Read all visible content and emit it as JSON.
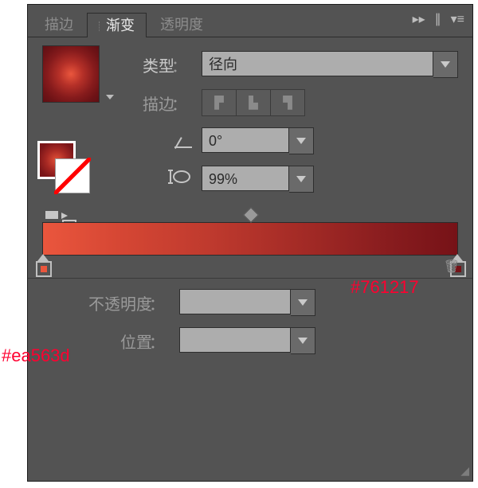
{
  "tabs": {
    "stroke": "描边",
    "gradient": "渐变",
    "transparency": "透明度"
  },
  "labels": {
    "type": "类型",
    "stroke": "描边",
    "opacity": "不透明度",
    "position": "位置",
    "colon": "："
  },
  "fields": {
    "type_value": "径向",
    "angle": "0°",
    "aspect": "99%",
    "opacity": "",
    "position": ""
  },
  "gradient": {
    "start": "#ea563d",
    "end": "#761217"
  },
  "annotations": {
    "start": "#ea563d",
    "end": "#761217"
  }
}
